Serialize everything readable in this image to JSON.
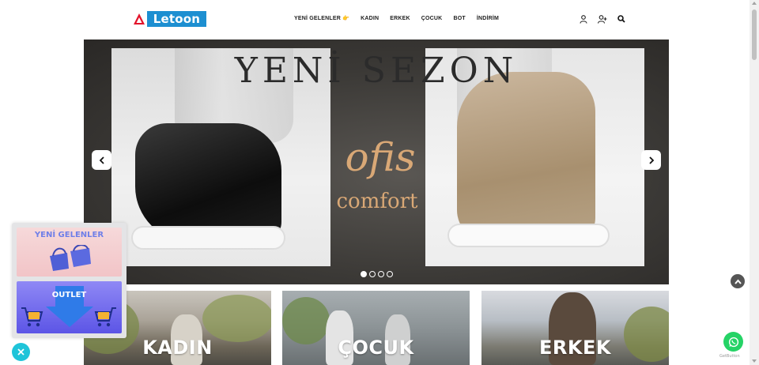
{
  "header": {
    "logo_text": "Letoon",
    "nav": [
      {
        "label": "YENİ GELENLER",
        "emoji": "👉"
      },
      {
        "label": "KADIN"
      },
      {
        "label": "ERKEK"
      },
      {
        "label": "ÇOCUK"
      },
      {
        "label": "BOT"
      },
      {
        "label": "İNDİRİM"
      }
    ],
    "icons": [
      "user-icon",
      "add-user-icon",
      "search-icon"
    ]
  },
  "hero": {
    "title": "YENİ SEZON",
    "script": "ofis",
    "subtitle": "comfort",
    "slides": 4,
    "active_slide": 1
  },
  "categories": [
    {
      "label": "KADIN"
    },
    {
      "label": "ÇOCUK"
    },
    {
      "label": "ERKEK"
    }
  ],
  "promo": {
    "new_arrivals": "YENİ GELENLER",
    "outlet": "OUTLET"
  },
  "getbutton": "GetButton",
  "colors": {
    "logo_red": "#e3132a",
    "logo_blue": "#1d8fd1",
    "close_cyan": "#1fc4d9",
    "whatsapp_green": "#25d366",
    "promo_text": "#6f7fe8"
  }
}
